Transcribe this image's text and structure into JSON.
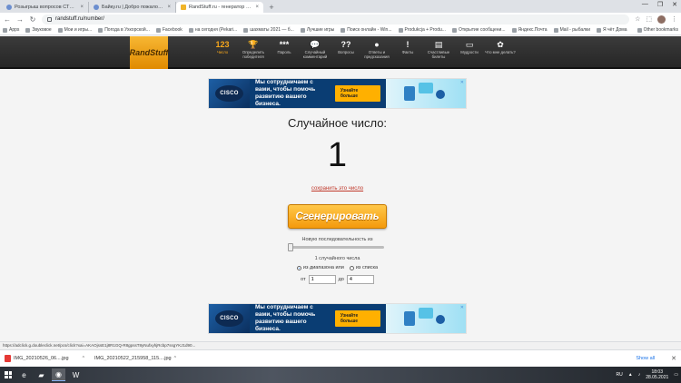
{
  "browser": {
    "tabs": [
      {
        "title": "Розыгрыш вопросов СТИЛИСТ...",
        "active": false
      },
      {
        "title": "Байку.ru | Добро пожаловать",
        "active": false
      },
      {
        "title": "RandStuff.ru - генератор случай...",
        "active": true
      }
    ],
    "new_tab_label": "+",
    "url": "randstuff.ru/number/",
    "bookmarks": [
      "Apps",
      "Звуковое",
      "Мои и игры...",
      "Погода в Ухкорской...",
      "Facebook",
      "на сегодня (Pekari...",
      "шахматы 2021 — б...",
      "Лучшие игры",
      "Поиск онлайн - Win...",
      "Produkcja + Produ...",
      "Открытие сообщени...",
      "Яндекс.Почта",
      "Mail - рыбалки",
      "Я чёт Дома"
    ],
    "bookmarks_right": "Other bookmarks"
  },
  "site": {
    "logo": "RandStuff",
    "menu": [
      {
        "icon": "123",
        "label": "Число",
        "active": true
      },
      {
        "icon": "🏆",
        "label": "Определить победителя",
        "active": false
      },
      {
        "icon": "***",
        "label": "Пароль",
        "active": false
      },
      {
        "icon": "💬",
        "label": "Случайный комментарий",
        "active": false
      },
      {
        "icon": "??",
        "label": "Вопросы",
        "active": false
      },
      {
        "icon": "●",
        "label": "Ответы и предсказания",
        "active": false
      },
      {
        "icon": "!",
        "label": "Факты",
        "active": false
      },
      {
        "icon": "▤",
        "label": "Счастливые билеты",
        "active": false
      },
      {
        "icon": "▭",
        "label": "Мудрости",
        "active": false
      },
      {
        "icon": "✿",
        "label": "Что мне делать?",
        "active": false
      }
    ]
  },
  "ad": {
    "brand": "CISCO",
    "text": "Мы сотрудничаем с вами, чтобы помочь развитию вашего бизнеса.",
    "button": "Узнайте больше"
  },
  "generator": {
    "heading": "Случайное число:",
    "result": "1",
    "save_link": "сохранить это число",
    "button": "Сгенерировать",
    "sequence_label": "Новую последовательность из",
    "count_label": "1 случайного числа",
    "count_fraction": 0.0,
    "mode_range": "из диапазона или",
    "mode_list": "из списка",
    "from_label": "от",
    "from_value": "1",
    "to_label": "до",
    "to_value": "4"
  },
  "status_url": "https://adclick.g.doubleclick.net/pcs/click?xai=AKAOjssE1j8R1GQ-R8gpssT8yNufxyhjRcbp7ssgYKJ1d90...",
  "downloads": [
    {
      "name": "IMG_20210526_06....jpg"
    },
    {
      "name": "IMG_20210522_215958_115....jpg"
    }
  ],
  "downloads_show_all": "Show all",
  "taskbar": {
    "time": "18:03",
    "date": "28.05.2021",
    "lang": "RU"
  }
}
